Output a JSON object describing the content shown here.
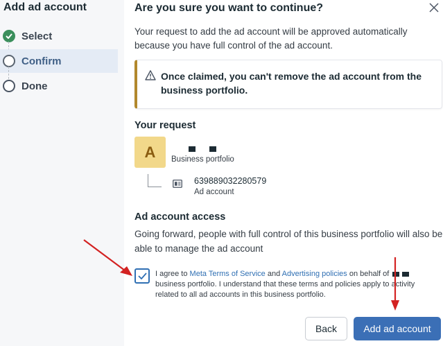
{
  "sidebar": {
    "title": "Add ad account",
    "steps": [
      {
        "label": "Select",
        "state": "done"
      },
      {
        "label": "Confirm",
        "state": "current"
      },
      {
        "label": "Done",
        "state": "pending"
      }
    ]
  },
  "dialog": {
    "title": "Are you sure you want to continue?",
    "description": "Your request to add the ad account will be approved automatically because you have full control of the ad account.",
    "warning": "Once claimed, you can't remove the ad account from the business portfolio.",
    "request": {
      "heading": "Your request",
      "avatar_letter": "A",
      "portfolio_label": "Business portfolio",
      "account_id": "639889032280579",
      "account_label": "Ad account"
    },
    "access": {
      "heading": "Ad account access",
      "description": "Going forward, people with full control of this business portfolio will also be able to manage the ad account"
    },
    "agreement": {
      "checked": true,
      "prefix": "I agree to ",
      "link_tos": "Meta Terms of Service",
      "and": " and ",
      "link_ads": "Advertising policies",
      "middle": " on behalf of ",
      "suffix": " business portfolio. I understand that these terms and policies apply to activity related to all ad accounts in this business portfolio."
    },
    "buttons": {
      "back": "Back",
      "add": "Add ad account"
    }
  },
  "colors": {
    "accent": "#3b6fb6",
    "success": "#3b8f5c",
    "warning_border": "#b2882c",
    "annotation_arrow": "#d32222"
  },
  "icons": {
    "close": "close-icon",
    "warning": "warning-triangle-icon",
    "checkmark": "checkmark-icon",
    "ad_account": "ad-account-icon"
  }
}
